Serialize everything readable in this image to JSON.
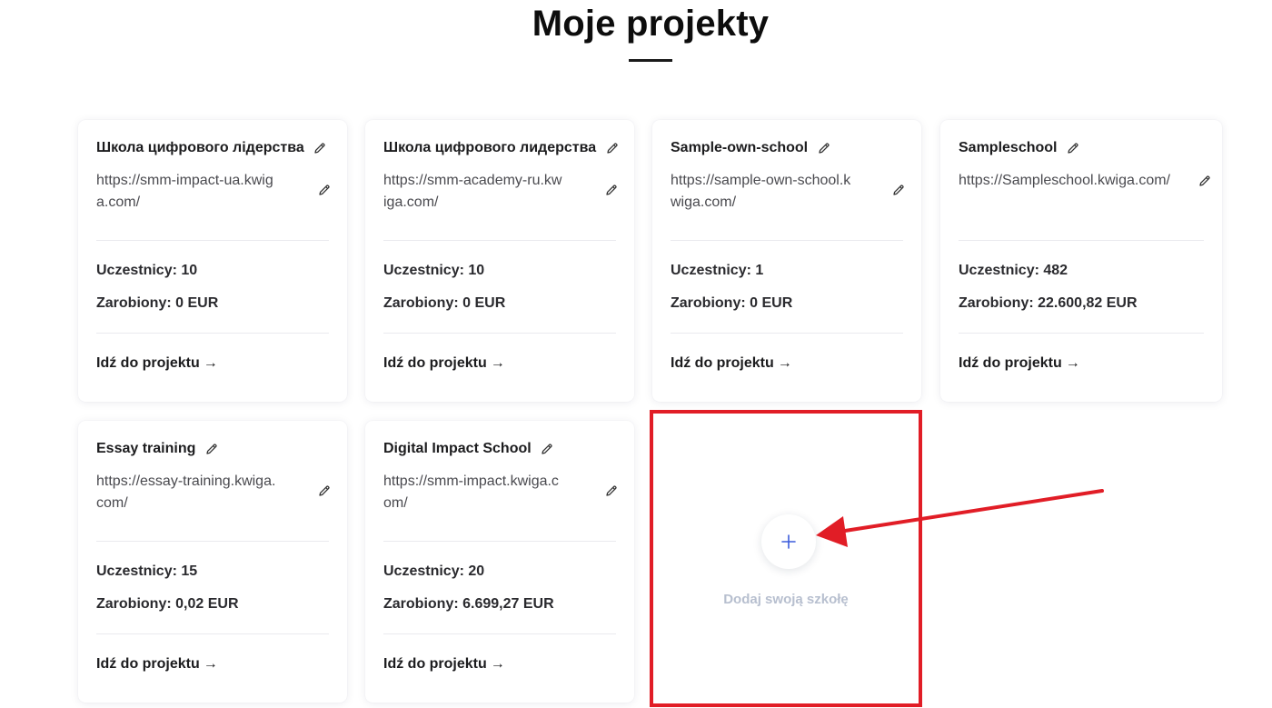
{
  "header": {
    "title": "Moje projekty"
  },
  "labels": {
    "participants": "Uczestnicy:",
    "earned": "Zarobiony:",
    "go_to_project": "Idź do projektu",
    "go_arrow": "→"
  },
  "projects": [
    {
      "name": "Школа цифрового лідерства",
      "url": "https://smm-impact-ua.kwiga.com/",
      "participants": "10",
      "earned": "0 EUR"
    },
    {
      "name": "Школа цифрового лидерства",
      "url": "https://smm-academy-ru.kwiga.com/",
      "participants": "10",
      "earned": "0 EUR"
    },
    {
      "name": "Sample-own-school",
      "url": "https://sample-own-school.kwiga.com/",
      "participants": "1",
      "earned": "0 EUR"
    },
    {
      "name": "Sampleschool",
      "url": "https://Sampleschool.kwiga.com/",
      "participants": "482",
      "earned": "22.600,82 EUR"
    },
    {
      "name": "Essay training",
      "url": "https://essay-training.kwiga.com/",
      "participants": "15",
      "earned": "0,02 EUR"
    },
    {
      "name": "Digital Impact School",
      "url": "https://smm-impact.kwiga.com/",
      "participants": "20",
      "earned": "6.699,27 EUR"
    }
  ],
  "add_school": {
    "label": "Dodaj swoją szkołę",
    "icon": "plus-icon"
  },
  "colors": {
    "annotation_red": "#e11d26",
    "plus_blue": "#3b5bdb",
    "add_label": "#b7bfcf"
  }
}
